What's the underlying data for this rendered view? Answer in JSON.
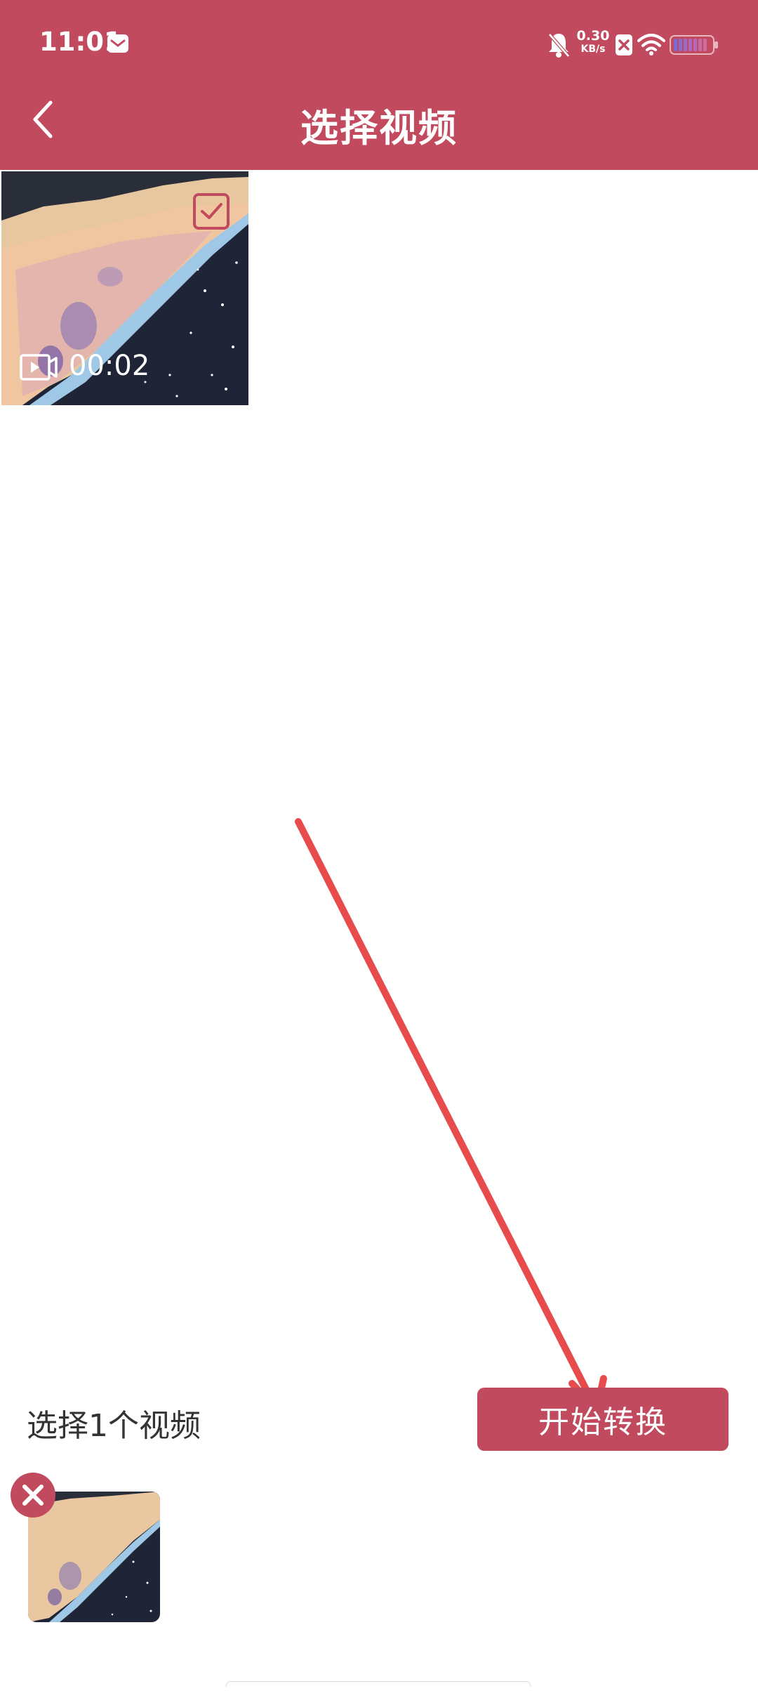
{
  "status_bar": {
    "time": "11:01",
    "net_speed_value": "0.30",
    "net_speed_unit": "KB/s",
    "icons": [
      "mail-icon",
      "bell-muted-icon",
      "close-box-icon",
      "wifi-icon",
      "battery-icon"
    ]
  },
  "header": {
    "title": "选择视频",
    "back_icon": "chevron-left-icon"
  },
  "video_grid": [
    {
      "duration": "00:02",
      "selected": true
    }
  ],
  "footer": {
    "selected_count_label": "选择1个视频",
    "start_button_label": "开始转换"
  },
  "colors": {
    "accent": "#c24a5e",
    "annotation_arrow": "#e84b4b"
  }
}
